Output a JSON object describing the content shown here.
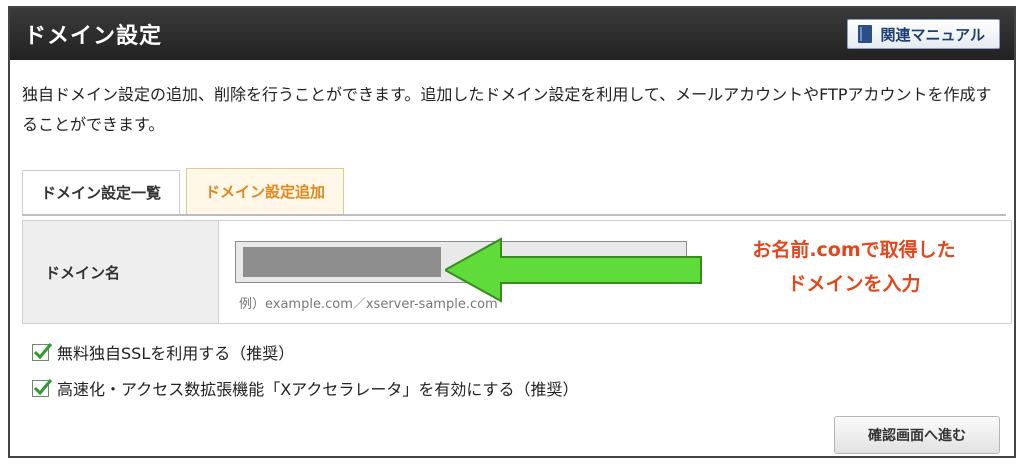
{
  "header": {
    "title": "ドメイン設定",
    "manual_label": "関連マニュアル",
    "manual_icon": "book-icon"
  },
  "description": "独自ドメイン設定の追加、削除を行うことができます。追加したドメイン設定を利用して、メールアカウントやFTPアカウントを作成することができます。",
  "tabs": [
    {
      "label": "ドメイン設定一覧",
      "active": false
    },
    {
      "label": "ドメイン設定追加",
      "active": true
    }
  ],
  "form": {
    "domain_label": "ドメイン名",
    "domain_value": "",
    "example": "例）example.com／xserver-sample.com"
  },
  "annotation": {
    "line1": "お名前.comで取得した",
    "line2": "ドメインを入力",
    "color": "#e3461b",
    "arrow_color": "#5fdc3a"
  },
  "options": [
    {
      "label": "無料独自SSLを利用する（推奨）",
      "checked": true
    },
    {
      "label": "高速化・アクセス数拡張機能「Xアクセラレータ」を有効にする（推奨）",
      "checked": true
    }
  ],
  "confirm_label": "確認画面へ進む"
}
